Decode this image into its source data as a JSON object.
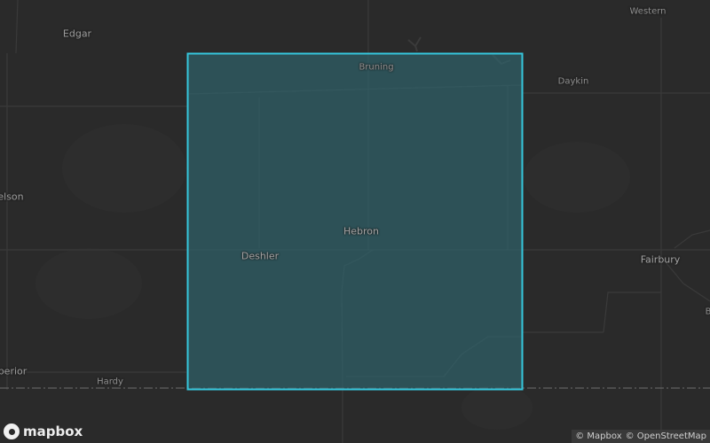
{
  "map": {
    "places": [
      {
        "name": "Western"
      },
      {
        "name": "Edgar"
      },
      {
        "name": "Bruning"
      },
      {
        "name": "Daykin"
      },
      {
        "name": "elson"
      },
      {
        "name": "Hebron"
      },
      {
        "name": "Deshler"
      },
      {
        "name": "Fairbury"
      },
      {
        "name": "perior"
      },
      {
        "name": "Hardy"
      },
      {
        "name": "B"
      }
    ],
    "selection_color": "#35c6dc",
    "selection_fill": "#2f6770",
    "logo": {
      "text": "mapbox"
    },
    "attribution": {
      "mapbox": "© Mapbox",
      "osm": "© OpenStreetMap"
    }
  }
}
